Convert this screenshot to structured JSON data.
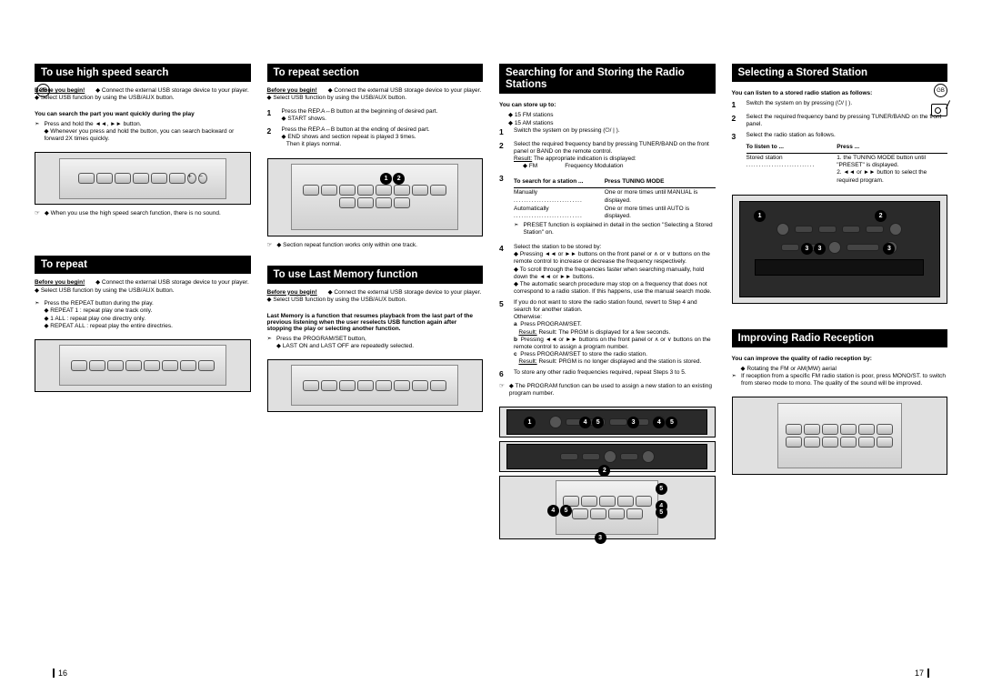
{
  "page_left_num": "16",
  "page_right_num": "17",
  "lang_badge": "GB",
  "col1": {
    "a": {
      "title": "To use high speed search",
      "before": "Before you begin!",
      "before_list": [
        "Connect the external USB storage device to your player.",
        "Select USB function by using the USB/AUX button."
      ],
      "bold": "You can search the part you want quickly during the play",
      "p1_lead": "Press and hold the ◄◄, ►► button.",
      "p1_note": "Whenever you press and hold the button, you can search backward or forward 2X   times quickly.",
      "hand_note": "When you use the high speed search function, there is no sound."
    },
    "b": {
      "title": "To repeat",
      "before": "Before you begin!",
      "before_list": [
        "Connect the external USB storage device to your player.",
        "Select USB function by using the USB/AUX button."
      ],
      "p1_lead": "Press the REPEAT button during the play.",
      "p1_list": [
        "REPEAT 1 : repeat play one track only.",
        "1 ALL : repeat play one directry only.",
        "REPEAT ALL : repeat play the entire directries."
      ]
    }
  },
  "col2": {
    "a": {
      "title": "To repeat section",
      "before": "Before you begin!",
      "before_list": [
        "Connect the external USB storage device to your player.",
        "Select USB function by using the USB/AUX button."
      ],
      "steps": [
        {
          "n": "1",
          "lead": "Press the REP.A↔B button at the beginning of desired part.",
          "bullets": [
            "START shows."
          ]
        },
        {
          "n": "2",
          "lead": "Press the REP.A↔B button at the ending of desired part.",
          "bullets": [
            "END shows and section repeat is played 3 times.",
            "Then it plays normal."
          ]
        }
      ],
      "hand_note": "Section repeat function works only within one track."
    },
    "b": {
      "title": "To use Last Memory function",
      "before": "Before you begin!",
      "before_list": [
        "Connect the external USB storage device to your player.",
        "Select USB function by using the USB/AUX button."
      ],
      "blurb": "Last Memory is a function that resumes playback from the last part of the previous listening when the user reselects USB function again after stopping the play or selecting another function.",
      "p1_lead": "Press the PROGRAM/SET button,",
      "p1_note": "LAST ON and LAST OFF are repeatedly selected."
    }
  },
  "col3": {
    "a": {
      "title": "Searching for and Storing the Radio Stations",
      "bold": "You can store up to:",
      "store": [
        "15 FM stations",
        "15 AM stations"
      ],
      "steps": [
        {
          "n": "1",
          "txt": "Switch the system on by pressing (⏻/ | )."
        },
        {
          "n": "2",
          "txt": "Select the required frequency band by pressing TUNER/BAND on the front panel or BAND on the remote control."
        }
      ],
      "result_lbl": "Result:",
      "result_txt": "The appropriate indication is displayed:",
      "freq_row_l": "FM",
      "freq_row_r": "Frequency Modulation",
      "search_hdr_l": "To search for a station ...",
      "search_hdr_r": "Press TUNING MODE",
      "search_rows": [
        {
          "l": "Manually",
          "r": "One or more times until MANUAL is displayed."
        },
        {
          "l": "Automatically",
          "r": "One or more times until AUTO is displayed."
        }
      ],
      "preset_note": "PRESET function is explained in detail in the section \"Selecting a Stored Station\" on.",
      "step4_lead": "Select the station to be stored by:",
      "step4_bullets": [
        "Pressing ◄◄ or ►► buttons on the front panel or  ∧  or  ∨ buttons on the remote control to increase or decrease the frequency respectively.",
        "To scroll through the frequencies faster when searching manually, hold down the ◄◄ or ►► buttons.",
        "The automatic search procedure may stop on a frequency that does not correspond to a radio station. If this happens, use the manual search mode."
      ],
      "step5": "If you do not want to store the radio station found, revert to Step 4 and search for another station.",
      "otherwise": "Otherwise:",
      "step5a_lbl": "a",
      "step5a_txt": "Press PROGRAM/SET.",
      "step5a_res": "Result: The PRGM is displayed for a few seconds.",
      "step5b_lbl": "b",
      "step5b_txt": "Pressing ◄◄ or ►► buttons on the front panel or  ∧  or  ∨ buttons on the remote control to assign a program number.",
      "step5c_lbl": "c",
      "step5c_txt": "Press PROGRAM/SET to store the radio station.",
      "step5c_res": "Result: PRGM is no longer displayed and the station is stored.",
      "step6": "To store any other radio frequencies required, repeat Steps 3 to 5.",
      "hand_note": "The PROGRAM function can be used to assign a new station to an existing program number."
    }
  },
  "col4": {
    "a": {
      "title": "Selecting a Stored Station",
      "bold": "You can listen to a stored radio station as follows:",
      "steps": [
        {
          "n": "1",
          "txt": "Switch the system on by pressing (⏻/ | )."
        },
        {
          "n": "2",
          "txt": "Select the required frequency band by pressing TUNER/BAND on the front panel."
        },
        {
          "n": "3",
          "txt": "Select the radio station as follows."
        }
      ],
      "tbl_hdr_l": "To listen to ...",
      "tbl_hdr_r": "Press ...",
      "tbl_row_l": "Stored station",
      "tbl_row_r1": "1. the TUNING MODE button until \"PRESET\" is displayed.",
      "tbl_row_r2": "2. ◄◄ or ►► button to select the required program."
    },
    "b": {
      "title": "Improving Radio Reception",
      "bold": "You can improve the quality of radio reception by:",
      "bullet": "Rotating the FM or AM(MW) aerial",
      "p_txt": "If reception from a specific FM radio station is poor, press MONO/ST. to switch from stereo mode to mono. The quality of the sound will be improved."
    }
  },
  "icons": {
    "ptr": "➣",
    "hand": "☞",
    "diamond": "◆"
  }
}
